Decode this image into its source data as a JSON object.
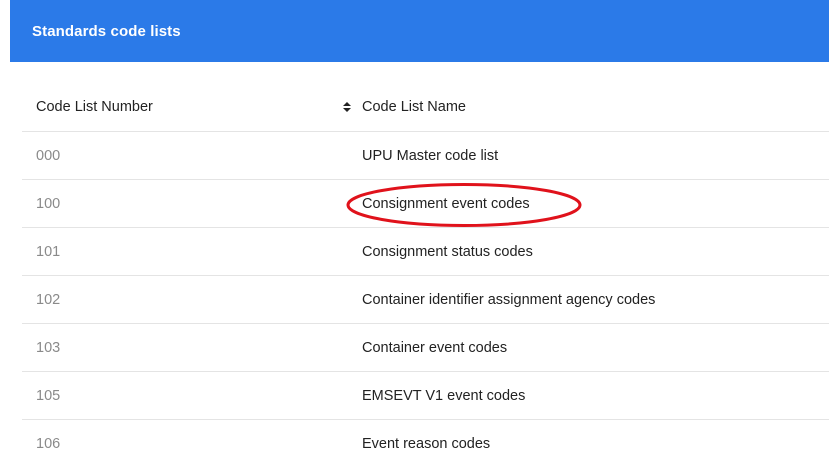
{
  "header": {
    "title": "Standards code lists"
  },
  "table": {
    "columns": {
      "number": "Code List Number",
      "name": "Code List Name"
    },
    "rows": [
      {
        "number": "000",
        "name": "UPU Master code list"
      },
      {
        "number": "100",
        "name": "Consignment event codes"
      },
      {
        "number": "101",
        "name": "Consignment status codes"
      },
      {
        "number": "102",
        "name": "Container identifier assignment agency codes"
      },
      {
        "number": "103",
        "name": "Container event codes"
      },
      {
        "number": "105",
        "name": "EMSEVT V1 event codes"
      },
      {
        "number": "106",
        "name": "Event reason codes"
      }
    ]
  },
  "icons": {
    "sort": "sort-icon",
    "annotation": "red-ellipse-highlight"
  },
  "colors": {
    "header_bg": "#2b7ae8",
    "header_text": "#ffffff",
    "highlight": "#e0121b"
  }
}
